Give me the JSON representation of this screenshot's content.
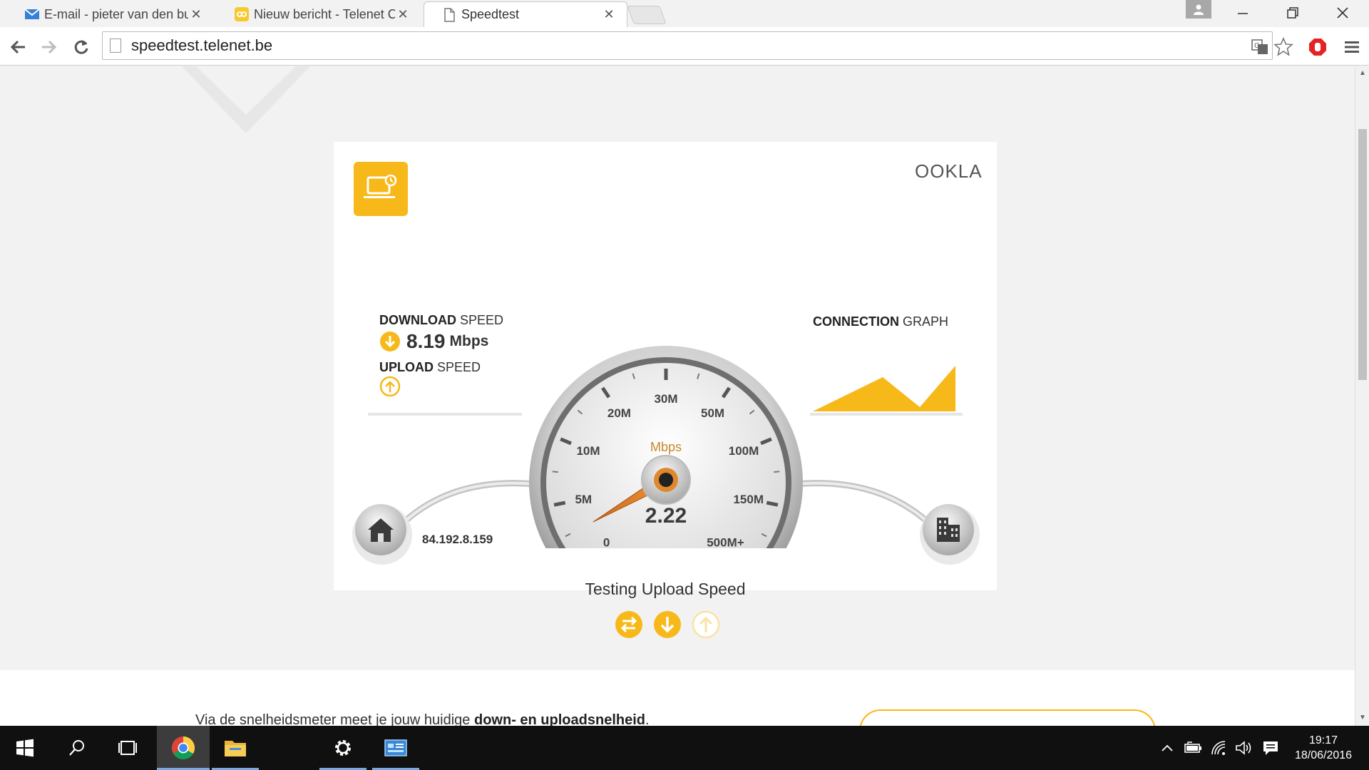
{
  "browser": {
    "tabs": [
      {
        "title": "E-mail - pieter van den bu",
        "icon": "mail-icon"
      },
      {
        "title": "Nieuw bericht - Telenet Co",
        "icon": "telenet-icon"
      },
      {
        "title": "Speedtest",
        "icon": "page-icon"
      }
    ],
    "close_glyph": "✕",
    "url": "speedtest.telenet.be"
  },
  "speedtest": {
    "brand": "OOKLA",
    "download_label_bold": "DOWNLOAD",
    "download_label_rest": " SPEED",
    "download_value": "8.19",
    "download_unit": "Mbps",
    "upload_label_bold": "UPLOAD",
    "upload_label_rest": " SPEED",
    "graph_label_bold": "CONNECTION",
    "graph_label_rest": " GRAPH",
    "gauge_unit": "Mbps",
    "gauge_value": "2.22",
    "gauge_value_numeric": 2.22,
    "gauge_ticks": [
      "0",
      "5M",
      "10M",
      "20M",
      "30M",
      "50M",
      "100M",
      "150M",
      "500M+"
    ],
    "ip_address": "84.192.8.159",
    "status": "Testing Upload Speed",
    "accent_color": "#f7b81a",
    "phase_icons": [
      "ping-icon",
      "download-icon",
      "upload-icon"
    ]
  },
  "page": {
    "info_text_plain": "Via de snelheidsmeter meet je jouw huidige ",
    "info_text_bold": "down- en uploadsnelheid",
    "info_text_end": "."
  },
  "taskbar": {
    "time": "19:17",
    "date": "18/06/2016",
    "apps": [
      "start-icon",
      "search-icon",
      "task-view-icon",
      "chrome-icon",
      "file-explorer-icon",
      "settings-icon",
      "control-panel-icon"
    ]
  }
}
